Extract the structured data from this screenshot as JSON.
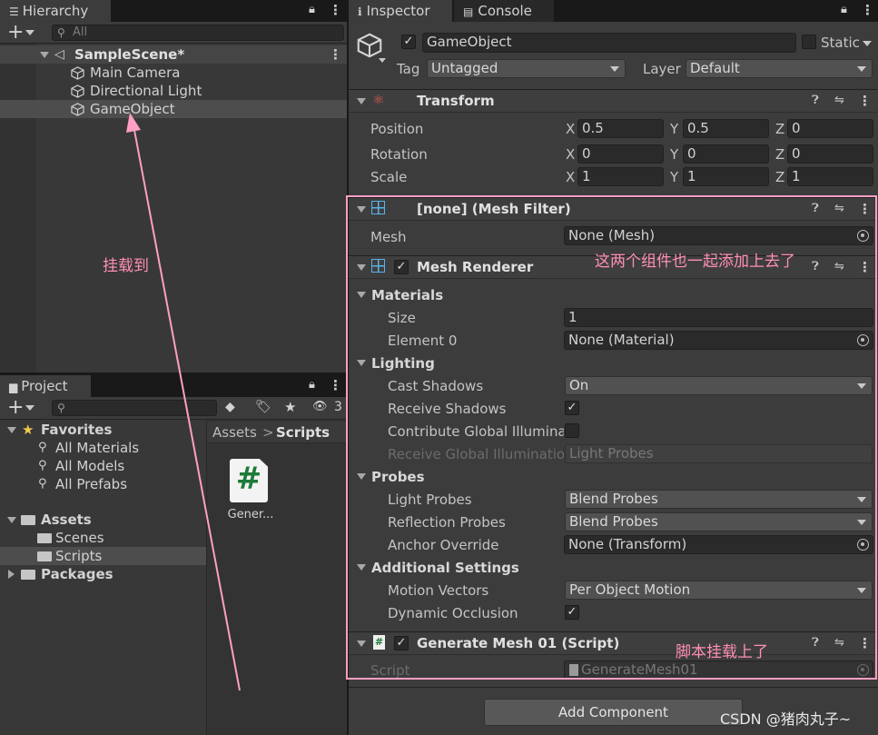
{
  "hierarchy": {
    "tab_label": "Hierarchy",
    "add_label": "+",
    "search_placeholder": "All",
    "scene": "SampleScene*",
    "items": [
      "Main Camera",
      "Directional Light",
      "GameObject"
    ]
  },
  "project": {
    "tab_label": "Project",
    "add_label": "+",
    "hidden_count": "3",
    "favorites": {
      "label": "Favorites",
      "items": [
        "All Materials",
        "All Models",
        "All Prefabs"
      ]
    },
    "assets": {
      "label": "Assets",
      "items": [
        "Scenes",
        "Scripts"
      ]
    },
    "packages_label": "Packages",
    "breadcrumb": {
      "root": "Assets",
      "sep": ">",
      "current": "Scripts"
    },
    "file": {
      "glyph": "#",
      "name": "Gener..."
    }
  },
  "inspector": {
    "tab_label": "Inspector",
    "console_label": "Console",
    "object_name": "GameObject",
    "static_label": "Static",
    "tag_label": "Tag",
    "tag_value": "Untagged",
    "layer_label": "Layer",
    "layer_value": "Default",
    "transform": {
      "title": "Transform",
      "rows": [
        {
          "label": "Position",
          "x": "0.5",
          "y": "0.5",
          "z": "0"
        },
        {
          "label": "Rotation",
          "x": "0",
          "y": "0",
          "z": "0"
        },
        {
          "label": "Scale",
          "x": "1",
          "y": "1",
          "z": "1"
        }
      ],
      "axis": {
        "x": "X",
        "y": "Y",
        "z": "Z"
      }
    },
    "mesh_filter": {
      "title": "[none] (Mesh Filter)",
      "mesh_label": "Mesh",
      "mesh_value": "None (Mesh)"
    },
    "mesh_renderer": {
      "title": "Mesh Renderer",
      "materials_label": "Materials",
      "size_label": "Size",
      "size_value": "1",
      "element0_label": "Element 0",
      "element0_value": "None (Material)",
      "lighting_label": "Lighting",
      "cast_shadows_label": "Cast Shadows",
      "cast_shadows_value": "On",
      "receive_shadows_label": "Receive Shadows",
      "contribute_gi_label": "Contribute Global Illuminati",
      "receive_gi_label": "Receive Global Illuminatior",
      "receive_gi_value": "Light Probes",
      "probes_label": "Probes",
      "light_probes_label": "Light Probes",
      "light_probes_value": "Blend Probes",
      "reflection_probes_label": "Reflection Probes",
      "reflection_probes_value": "Blend Probes",
      "anchor_label": "Anchor Override",
      "anchor_value": "None (Transform)",
      "additional_label": "Additional Settings",
      "motion_vectors_label": "Motion Vectors",
      "motion_vectors_value": "Per Object Motion",
      "dynamic_occlusion_label": "Dynamic Occlusion"
    },
    "script": {
      "title": "Generate Mesh 01 (Script)",
      "script_label": "Script",
      "script_value": "GenerateMesh01"
    },
    "add_component": "Add Component"
  },
  "annotations": {
    "attach_to": "挂载到",
    "components_added": "这两个组件也一起添加上去了",
    "script_attached": "脚本挂载上了",
    "watermark": "CSDN @猪肉丸子~"
  },
  "colors": {
    "highlight": "#ff9fc3",
    "panel": "#383838",
    "selected": "#4d4d4d"
  }
}
